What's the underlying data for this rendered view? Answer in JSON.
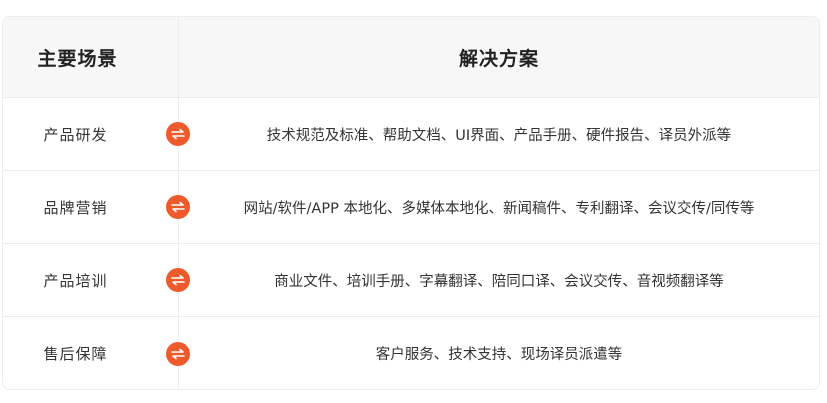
{
  "header": {
    "scene": "主要场景",
    "solution": "解决方案"
  },
  "rows": [
    {
      "scene": "产品研发",
      "solution": "技术规范及标准、帮助文档、UI界面、产品手册、硬件报告、译员外派等"
    },
    {
      "scene": "品牌营销",
      "solution": "网站/软件/APP 本地化、多媒体本地化、新闻稿件、专利翻译、会议交传/同传等"
    },
    {
      "scene": "产品培训",
      "solution": "商业文件、培训手册、字幕翻译、陪同口译、会议交传、音视频翻译等"
    },
    {
      "scene": "售后保障",
      "solution": "客户服务、技术支持、现场译员派遣等"
    }
  ],
  "icons": {
    "row_badge": "swap-arrows-icon"
  },
  "colors": {
    "accent": "#ee5a2b",
    "header_bg": "#f7f7f7",
    "border": "#ececec"
  }
}
